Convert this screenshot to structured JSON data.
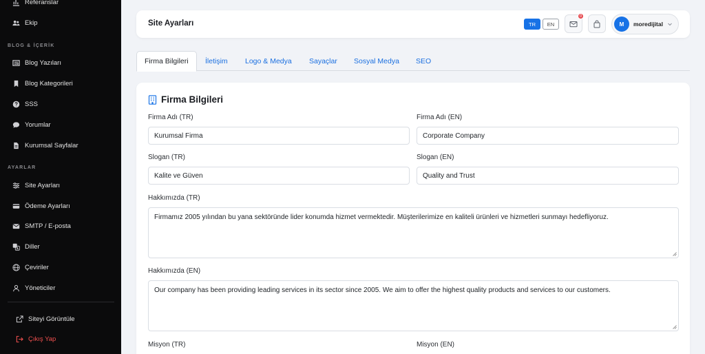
{
  "sidebar": {
    "items_top": [
      {
        "label": "Referanslar",
        "icon": "chart-icon"
      },
      {
        "label": "Ekip",
        "icon": "users-icon"
      }
    ],
    "section_blog": "BLOG & İÇERİK",
    "items_blog": [
      {
        "label": "Blog Yazıları",
        "icon": "newspaper-icon"
      },
      {
        "label": "Blog Kategorileri",
        "icon": "bookmark-icon"
      },
      {
        "label": "SSS",
        "icon": "question-icon"
      },
      {
        "label": "Yorumlar",
        "icon": "comment-icon"
      },
      {
        "label": "Kurumsal Sayfalar",
        "icon": "file-icon"
      }
    ],
    "section_settings": "AYARLAR",
    "items_settings": [
      {
        "label": "Site Ayarları",
        "icon": "sliders-icon"
      },
      {
        "label": "Ödeme Ayarları",
        "icon": "credit-card-icon"
      },
      {
        "label": "SMTP / E-posta",
        "icon": "envelope-icon"
      },
      {
        "label": "Diller",
        "icon": "translate-icon"
      },
      {
        "label": "Çeviriler",
        "icon": "globe-icon"
      },
      {
        "label": "Yöneticiler",
        "icon": "user-icon"
      }
    ],
    "view_site": "Siteyi Görüntüle",
    "logout": "Çıkış Yap",
    "logout_color": "#f0504f"
  },
  "header": {
    "title": "Site Ayarları",
    "lang_tr": "TR",
    "lang_en": "EN",
    "mail_badge": "0",
    "user_initial": "M",
    "user_name": "moredijital",
    "accent": "#1772e6"
  },
  "tabs": [
    {
      "label": "Firma Bilgileri",
      "active": true
    },
    {
      "label": "İletişim",
      "active": false
    },
    {
      "label": "Logo & Medya",
      "active": false
    },
    {
      "label": "Sayaçlar",
      "active": false
    },
    {
      "label": "Sosyal Medya",
      "active": false
    },
    {
      "label": "SEO",
      "active": false
    }
  ],
  "form": {
    "title": "Firma Bilgileri",
    "company_name_tr_label": "Firma Adı (TR)",
    "company_name_tr": "Kurumsal Firma",
    "company_name_en_label": "Firma Adı (EN)",
    "company_name_en": "Corporate Company",
    "slogan_tr_label": "Slogan (TR)",
    "slogan_tr": "Kalite ve Güven",
    "slogan_en_label": "Slogan (EN)",
    "slogan_en": "Quality and Trust",
    "about_tr_label": "Hakkımızda (TR)",
    "about_tr": "Firmamız 2005 yılından bu yana sektöründe lider konumda hizmet vermektedir. Müşterilerimize en kaliteli ürünleri ve hizmetleri sunmayı hedefliyoruz.",
    "about_en_label": "Hakkımızda (EN)",
    "about_en": "Our company has been providing leading services in its sector since 2005. We aim to offer the highest quality products and services to our customers.",
    "mission_tr_label": "Misyon (TR)",
    "mission_en_label": "Misyon (EN)"
  }
}
